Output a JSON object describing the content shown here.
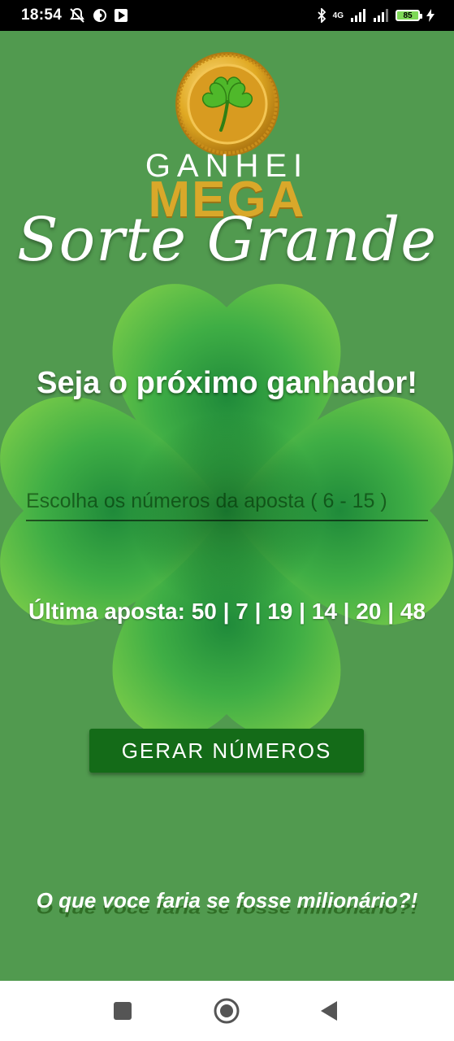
{
  "status_bar": {
    "time": "18:54",
    "network": "4G",
    "battery": "85",
    "icons": [
      "notifications-off-icon",
      "app-icon",
      "play-store-icon",
      "bluetooth-icon",
      "signal-icon",
      "signal-icon",
      "battery-icon",
      "charging-icon"
    ]
  },
  "logo": {
    "line1": "GANHEI",
    "line2": "MEGA",
    "line3": "Sorte Grande"
  },
  "headline": "Seja o próximo ganhador!",
  "bet_input": {
    "placeholder": "Escolha os números da aposta ( 6 - 15 )",
    "value": ""
  },
  "last_bet": {
    "label": "Última aposta:",
    "numbers_text": "50 | 7 | 19 | 14 | 20 | 48"
  },
  "generate_button": "GERAR NÚMEROS",
  "question": "O que voce faria se fosse milionário?!",
  "colors": {
    "background": "#519a4f",
    "button": "#146b18",
    "clover_light": "#7ccf45",
    "clover_dark": "#2f9e3f",
    "gold": "#d9a82a"
  },
  "nav_bar": {
    "items": [
      "recent-apps-icon",
      "home-icon",
      "back-icon"
    ]
  }
}
